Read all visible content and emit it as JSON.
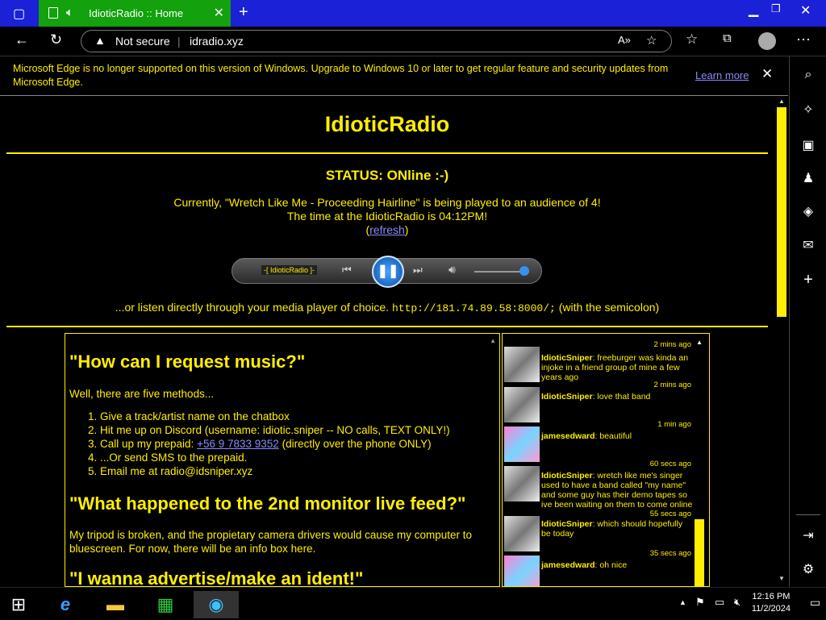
{
  "browser": {
    "tab_title": "IdioticRadio :: Home",
    "security_label": "Not secure",
    "url": "idradio.xyz",
    "notice_text": "Microsoft Edge is no longer supported on this version of Windows. Upgrade to Windows 10 or later to get regular feature and security updates from Microsoft Edge.",
    "learn_more": "Learn more"
  },
  "page": {
    "site_title": "IdioticRadio",
    "status": "STATUS: ONline :-)",
    "now_playing": "Currently, \"Wretch Like Me - Proceeding Hairline\" is being played to an audience of 4!",
    "time_line": "The time at the IdioticRadio is 04:12PM!",
    "refresh_open": "(",
    "refresh_label": "refresh",
    "refresh_close": ")",
    "player_label": "-[ IdioticRadio ]-",
    "player_volume": 0.85,
    "direct_prefix": "...or listen directly through your media player of choice.",
    "direct_url": "http://181.74.89.58:8000/;",
    "direct_suffix": "(with the semicolon)"
  },
  "faq": {
    "q1": "\"How can I request music?\"",
    "q1_intro": "Well, there are five methods...",
    "methods": [
      "Give a track/artist name on the chatbox",
      "Hit me up on Discord (username: idiotic.sniper -- NO calls, TEXT ONLY!)",
      "Call up my prepaid:",
      "...Or send SMS to the prepaid.",
      "Email me at radio@idsniper.xyz"
    ],
    "phone": "+56 9 7833 9352",
    "phone_note": "(directly over the phone ONLY)",
    "q2": "\"What happened to the 2nd monitor live feed?\"",
    "q2_answer": "My tripod is broken, and the propietary camera drivers would cause my computer to bluescreen. For now, there will be an info box here.",
    "q3": "\"I wanna advertise/make an ident!\""
  },
  "chat": [
    {
      "time": "2 mins ago",
      "user": "IdioticSniper",
      "text": ": freeburger was kinda an injoke in a friend group of mine a few years ago",
      "avatar": "sniper-avatar"
    },
    {
      "time": "2 mins ago",
      "user": "IdioticSniper",
      "text": ": love that band",
      "avatar": "sniper-avatar"
    },
    {
      "time": "1 min ago",
      "user": "jamesedward",
      "text": ": beautiful",
      "avatar": "james-avatar"
    },
    {
      "time": "60 secs ago",
      "user": "IdioticSniper",
      "text": ": wretch like me's singer used to have a band called \"my name\" and some guy has their demo tapes so ive been waiting on them to come online",
      "avatar": "sniper-avatar"
    },
    {
      "time": "55 secs ago",
      "user": "IdioticSniper",
      "text": ": which should hopefully be today",
      "avatar": "sniper-avatar"
    },
    {
      "time": "35 secs ago",
      "user": "jamesedward",
      "text": ": oh nice",
      "avatar": "james-avatar"
    }
  ],
  "taskbar": {
    "time": "12:16 PM",
    "date": "11/2/2024"
  },
  "colors": {
    "accent": "#ffee00",
    "link": "#8a8aff",
    "titlebar": "#1a21d6",
    "active_tab": "#13a10e"
  }
}
